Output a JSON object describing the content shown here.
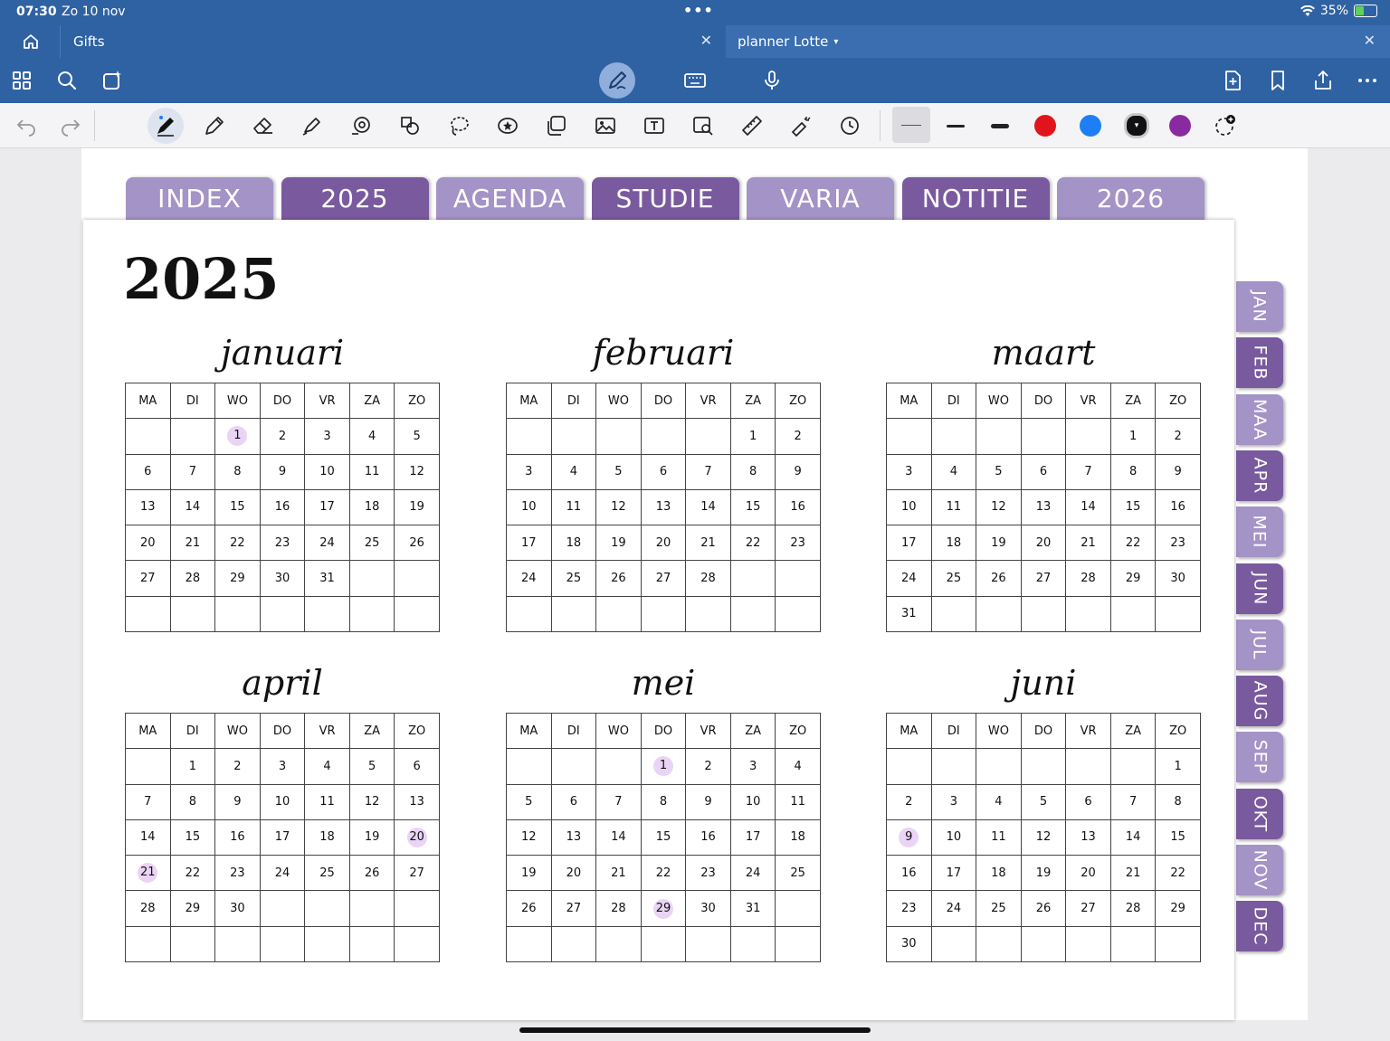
{
  "status": {
    "time": "07:30",
    "date": "Zo 10 nov",
    "battery": "35%"
  },
  "tabs": {
    "gifts": "Gifts",
    "planner": "planner Lotte"
  },
  "colors": {
    "bar": "#2f62a3",
    "tab_dark": "#7a5a9e",
    "tab_light": "#a493c6",
    "highlight": "#ead4f5"
  },
  "pen_colors": [
    "#e1141c",
    "#1e7ef5",
    "#111111",
    "#8a2aa0"
  ],
  "top_tabs": [
    {
      "label": "INDEX",
      "color": "#a493c6"
    },
    {
      "label": "2025",
      "color": "#7a5a9e"
    },
    {
      "label": "AGENDA",
      "color": "#a493c6"
    },
    {
      "label": "STUDIE",
      "color": "#7a5a9e"
    },
    {
      "label": "VARIA",
      "color": "#a493c6"
    },
    {
      "label": "NOTITIE",
      "color": "#7a5a9e"
    },
    {
      "label": "2026",
      "color": "#a493c6"
    }
  ],
  "side_tabs": [
    {
      "label": "JAN",
      "color": "#a493c6"
    },
    {
      "label": "FEB",
      "color": "#7a5a9e"
    },
    {
      "label": "MAA",
      "color": "#a493c6"
    },
    {
      "label": "APR",
      "color": "#7a5a9e"
    },
    {
      "label": "MEI",
      "color": "#a493c6"
    },
    {
      "label": "JUN",
      "color": "#7a5a9e"
    },
    {
      "label": "JUL",
      "color": "#a493c6"
    },
    {
      "label": "AUG",
      "color": "#7a5a9e"
    },
    {
      "label": "SEP",
      "color": "#a493c6"
    },
    {
      "label": "OKT",
      "color": "#7a5a9e"
    },
    {
      "label": "NOV",
      "color": "#a493c6"
    },
    {
      "label": "DEC",
      "color": "#7a5a9e"
    }
  ],
  "year": "2025",
  "weekdays": [
    "MA",
    "DI",
    "WO",
    "DO",
    "VR",
    "ZA",
    "ZO"
  ],
  "months": [
    {
      "name": "januari",
      "offset": 2,
      "days": 31,
      "highlight": [
        1
      ]
    },
    {
      "name": "februari",
      "offset": 5,
      "days": 28,
      "highlight": []
    },
    {
      "name": "maart",
      "offset": 5,
      "days": 31,
      "highlight": []
    },
    {
      "name": "april",
      "offset": 1,
      "days": 30,
      "highlight": [
        20,
        21
      ]
    },
    {
      "name": "mei",
      "offset": 3,
      "days": 31,
      "highlight": [
        1,
        29
      ]
    },
    {
      "name": "juni",
      "offset": 6,
      "days": 30,
      "highlight": [
        9
      ]
    }
  ]
}
